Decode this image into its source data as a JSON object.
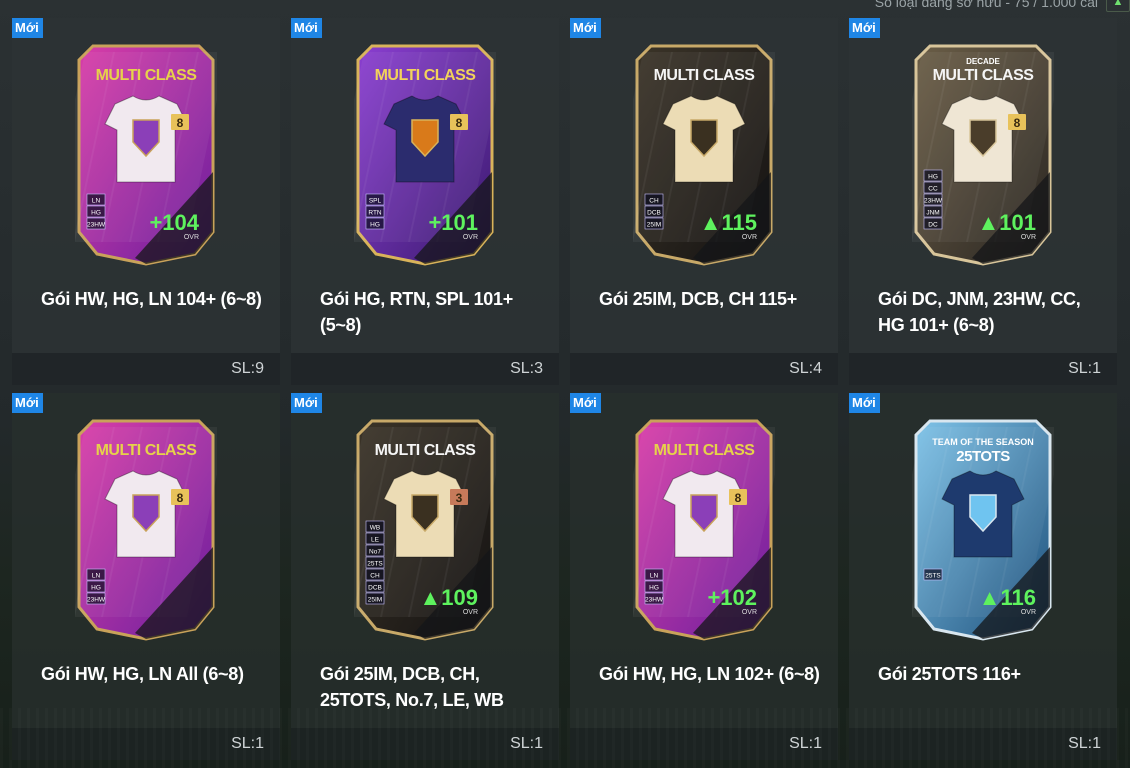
{
  "header": {
    "summary_text": "Số loại đang sở hữu - 75 / 1.000 cái",
    "action_icon": "arrow-icon"
  },
  "new_badge_label": "Mới",
  "packs": [
    {
      "name": "Gói HW, HG, LN 104+ (6~8)",
      "qty": "SL:9",
      "card": {
        "theme": "purple-pink",
        "title": "MULTI CLASS",
        "subtitle": "",
        "level": "8",
        "ovr": "104",
        "ovr_label": "OVR",
        "arrow": "+",
        "tags": [
          "LN",
          "HG",
          "23HW"
        ]
      }
    },
    {
      "name": "Gói HG, RTN, SPL 101+ (5~8)",
      "qty": "SL:3",
      "card": {
        "theme": "purple-gold",
        "title": "MULTI CLASS",
        "subtitle": "",
        "level": "8",
        "ovr": "101",
        "ovr_label": "OVR",
        "arrow": "+",
        "tags": [
          "SPL",
          "RTN",
          "HG"
        ]
      }
    },
    {
      "name": "Gói 25IM, DCB, CH 115+",
      "qty": "SL:4",
      "card": {
        "theme": "black-gold",
        "title": "MULTI CLASS",
        "subtitle": "",
        "level": "",
        "ovr": "115",
        "ovr_label": "OVR",
        "arrow": "▲",
        "tags": [
          "CH",
          "DCB",
          "25IM"
        ]
      }
    },
    {
      "name": "Gói DC, JNM, 23HW, CC, HG 101+ (6~8)",
      "qty": "SL:1",
      "card": {
        "theme": "decade",
        "title": "MULTI CLASS",
        "subtitle": "DECADE",
        "level": "8",
        "ovr": "101",
        "ovr_label": "OVR",
        "arrow": "▲",
        "tags": [
          "HG",
          "CC",
          "23HW",
          "JNM",
          "DC"
        ]
      }
    },
    {
      "name": "Gói HW, HG, LN All (6~8)",
      "qty": "SL:1",
      "card": {
        "theme": "purple-pink",
        "title": "MULTI CLASS",
        "subtitle": "",
        "level": "8",
        "ovr": "",
        "ovr_label": "",
        "arrow": "",
        "tags": [
          "LN",
          "HG",
          "23HW"
        ]
      }
    },
    {
      "name": "Gói 25IM, DCB, CH, 25TOTS, No.7, LE, WB",
      "qty": "SL:1",
      "card": {
        "theme": "black-gold",
        "title": "MULTI CLASS",
        "subtitle": "",
        "level": "3",
        "ovr": "109",
        "ovr_label": "OVR",
        "arrow": "▲",
        "tags": [
          "WB",
          "LE",
          "No7",
          "25TS",
          "CH",
          "DCB",
          "25IM"
        ]
      }
    },
    {
      "name": "Gói HW, HG, LN 102+ (6~8)",
      "qty": "SL:1",
      "card": {
        "theme": "purple-pink",
        "title": "MULTI CLASS",
        "subtitle": "",
        "level": "8",
        "ovr": "102",
        "ovr_label": "OVR",
        "arrow": "+",
        "tags": [
          "LN",
          "HG",
          "23HW"
        ]
      }
    },
    {
      "name": "Gói 25TOTS 116+",
      "qty": "SL:1",
      "card": {
        "theme": "tots",
        "title": "25TOTS",
        "subtitle": "TEAM OF THE SEASON",
        "level": "",
        "ovr": "116",
        "ovr_label": "OVR",
        "arrow": "▲",
        "tags": [
          "25TS"
        ]
      }
    }
  ]
}
